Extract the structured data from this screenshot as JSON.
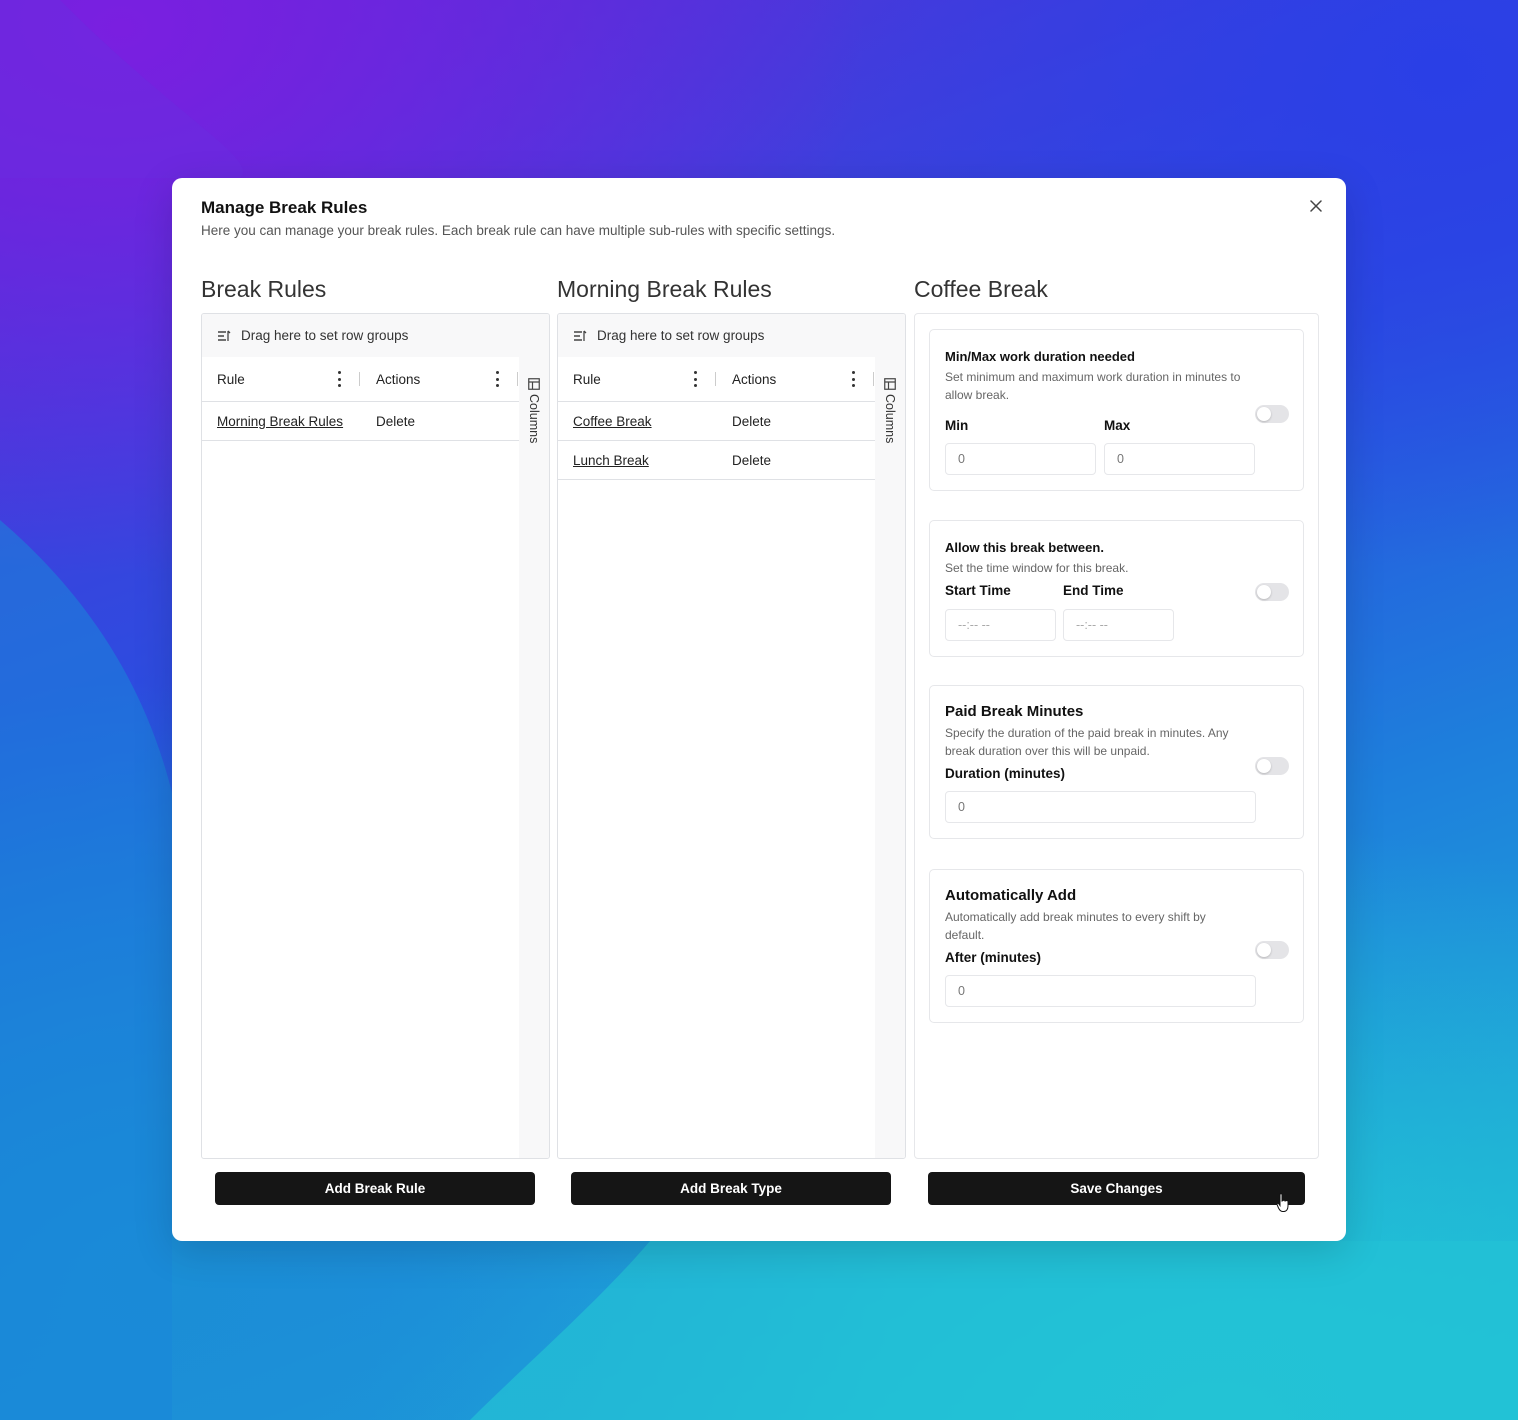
{
  "dialog": {
    "title": "Manage Break Rules",
    "description": "Here you can manage your break rules. Each break rule can have multiple sub-rules with specific settings.",
    "close_icon": "close-icon"
  },
  "break_rules": {
    "title": "Break Rules",
    "group_bar": "Drag here to set row groups",
    "columns": [
      "Rule",
      "Actions"
    ],
    "side_tab": "Columns",
    "rows": [
      {
        "rule": "Morning Break Rules",
        "action": "Delete"
      }
    ],
    "button": "Add Break Rule"
  },
  "morning_rules": {
    "title": "Morning Break Rules",
    "group_bar": "Drag here to set row groups",
    "columns": [
      "Rule",
      "Actions"
    ],
    "side_tab": "Columns",
    "rows": [
      {
        "rule": "Coffee Break",
        "action": "Delete"
      },
      {
        "rule": "Lunch Break",
        "action": "Delete"
      }
    ],
    "button": "Add Break Type"
  },
  "coffee_break": {
    "title": "Coffee Break",
    "cards": [
      {
        "title": "Min/Max work duration needed",
        "desc_line1": "Set minimum and maximum work duration in minutes to",
        "desc_line2": "allow break.",
        "min_label": "Min",
        "max_label": "Max",
        "min_value": "0",
        "max_value": "0",
        "enabled": false
      },
      {
        "title": "Allow this break between.",
        "desc_line1": "Set the time window for this break.",
        "start_label": "Start Time",
        "end_label": "End Time",
        "start_placeholder": "--:-- --",
        "end_placeholder": "--:-- --",
        "enabled": false
      },
      {
        "title": "Paid Break Minutes",
        "desc_line1": "Specify the duration of the paid break in minutes. Any",
        "desc_line2": "break duration over this will be unpaid.",
        "field_label": "Duration (minutes)",
        "value": "0",
        "enabled": false
      },
      {
        "title": "Automatically Add",
        "desc_line1": "Automatically add break minutes to every shift by",
        "desc_line2": "default.",
        "field_label": "After (minutes)",
        "value": "0",
        "enabled": false
      }
    ],
    "button": "Save Changes"
  }
}
